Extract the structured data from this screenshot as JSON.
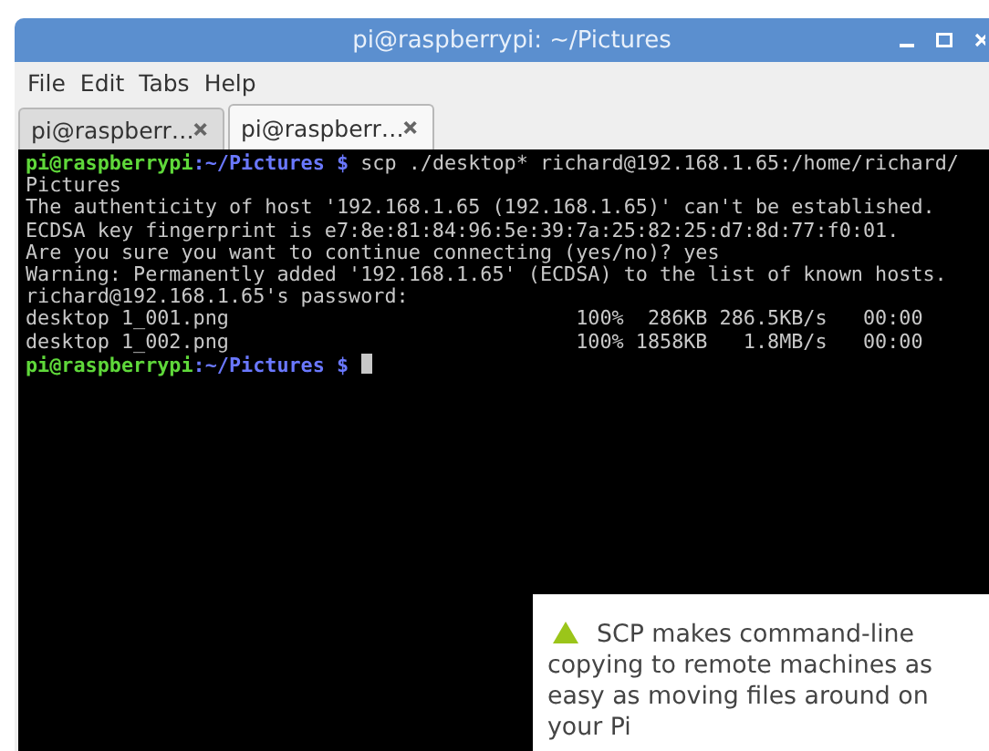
{
  "window": {
    "title": "pi@raspberrypi: ~/Pictures"
  },
  "menu": [
    "File",
    "Edit",
    "Tabs",
    "Help"
  ],
  "tabs": [
    {
      "label": "pi@raspberr…",
      "selected": false
    },
    {
      "label": "pi@raspberr…",
      "selected": true
    }
  ],
  "terminal": {
    "lines": [
      {
        "kind": "prompt",
        "user_host": "pi@raspberrypi",
        "path": ":~/Pictures $",
        "command": " scp ./desktop* richard@192.168.1.65:/home/richard/",
        "cursor": false
      },
      {
        "kind": "output",
        "text": "Pictures"
      },
      {
        "kind": "output",
        "text": "The authenticity of host '192.168.1.65 (192.168.1.65)' can't be established."
      },
      {
        "kind": "output",
        "text": "ECDSA key fingerprint is e7:8e:81:84:96:5e:39:7a:25:82:25:d7:8d:77:f0:01."
      },
      {
        "kind": "output",
        "text": "Are you sure you want to continue connecting (yes/no)? yes"
      },
      {
        "kind": "output",
        "text": "Warning: Permanently added '192.168.1.65' (ECDSA) to the list of known hosts."
      },
      {
        "kind": "output",
        "text": "richard@192.168.1.65's password:"
      },
      {
        "kind": "output",
        "text": "desktop 1_001.png                             100%  286KB 286.5KB/s   00:00"
      },
      {
        "kind": "output",
        "text": "desktop 1_002.png                             100% 1858KB   1.8MB/s   00:00"
      },
      {
        "kind": "prompt",
        "user_host": "pi@raspberrypi",
        "path": ":~/Pictures $",
        "cursor": true
      }
    ]
  },
  "caption": {
    "text": "SCP makes command-line copying to remote machines as easy as moving files around on your Pi"
  }
}
